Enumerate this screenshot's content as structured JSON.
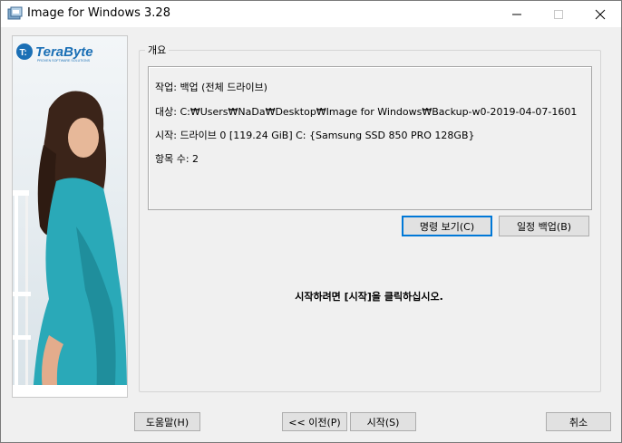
{
  "window": {
    "title": "Image for Windows 3.28"
  },
  "branding": {
    "logo_text": "TeraByte",
    "tagline": "PROVEN SOFTWARE SOLUTIONS"
  },
  "overview": {
    "label": "개요",
    "lines": [
      "작업: 백업 (전체 드라이브)",
      "대상: C:₩Users₩NaDa₩Desktop₩Image for Windows₩Backup-w0-2019-04-07-1601",
      "시작:  드라이브 0 [119.24 GiB] C: {Samsung SSD 850 PRO 128GB}",
      "항목 수: 2"
    ]
  },
  "buttons": {
    "view_command": "명령 보기(C)",
    "schedule_backup": "일정 백업(B)",
    "help": "도움말(H)",
    "back": "<< 이전(P)",
    "start": "시작(S)",
    "cancel": "취소"
  },
  "message": "시작하려면 [시작]을 클릭하십시오.",
  "colors": {
    "accent": "#0078d7",
    "logo_blue": "#1a6fb5",
    "dress": "#2aa9b8"
  }
}
